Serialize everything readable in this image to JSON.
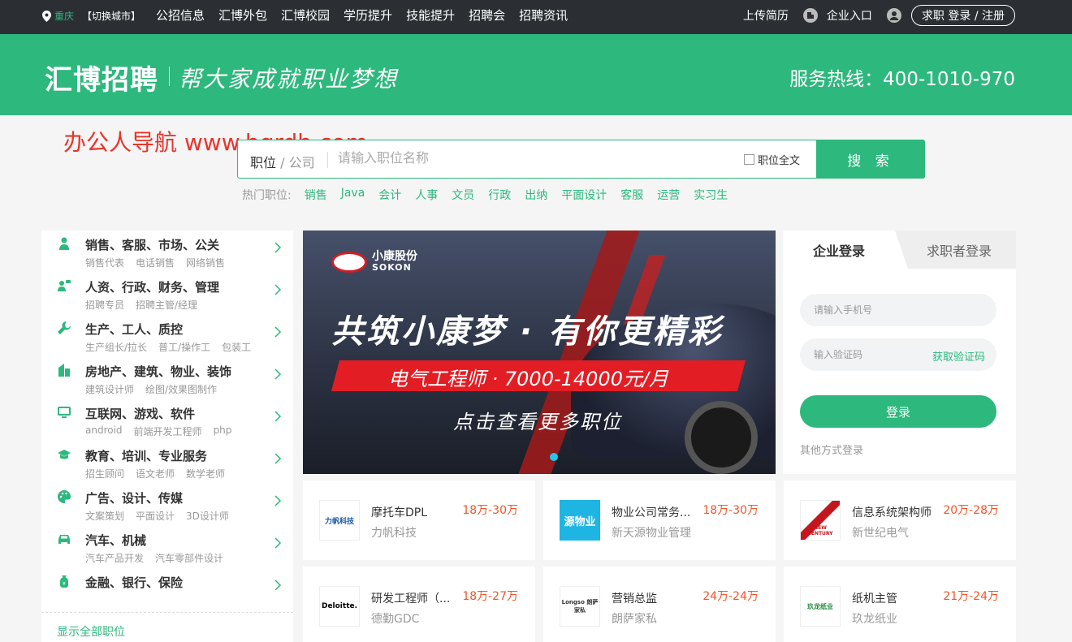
{
  "topbar": {
    "city": "重庆",
    "switch_city": "【切换城市】",
    "nav": [
      "公招信息",
      "汇博外包",
      "汇博校园",
      "学历提升",
      "技能提升",
      "招聘会",
      "招聘资讯"
    ],
    "upload_resume": "上传简历",
    "enterprise_entry": "企业入口",
    "jobseeker_login": "求职 登录 / 注册"
  },
  "header": {
    "logo": "汇博招聘",
    "slogan": "帮大家成就职业梦想",
    "hotline": "服务热线：400-1010-970"
  },
  "watermark": "办公人导航 www.bgrdh.com",
  "search": {
    "type_main": "职位",
    "type_sub": " / 公司",
    "placeholder": "请输入职位名称",
    "fulltext_label": "职位全文",
    "button": "搜 索"
  },
  "hot": {
    "label": "热门职位:",
    "keywords": [
      "销售",
      "Java",
      "会计",
      "人事",
      "文员",
      "行政",
      "出纳",
      "平面设计",
      "客服",
      "运营",
      "实习生"
    ]
  },
  "categories": [
    {
      "title": "销售、客服、市场、公关",
      "subs": [
        "销售代表",
        "电话销售",
        "网络销售"
      ],
      "icon": "person-icon"
    },
    {
      "title": "人资、行政、财务、管理",
      "subs": [
        "招聘专员",
        "招聘主管/经理"
      ],
      "icon": "team-icon"
    },
    {
      "title": "生产、工人、质控",
      "subs": [
        "生产组长/拉长",
        "普工/操作工",
        "包装工"
      ],
      "icon": "wrench-icon"
    },
    {
      "title": "房地产、建筑、物业、装饰",
      "subs": [
        "建筑设计师",
        "绘图/效果图制作"
      ],
      "icon": "building-icon"
    },
    {
      "title": "互联网、游戏、软件",
      "subs": [
        "android",
        "前端开发工程师",
        "php"
      ],
      "icon": "monitor-icon"
    },
    {
      "title": "教育、培训、专业服务",
      "subs": [
        "招生顾问",
        "语文老师",
        "数学老师"
      ],
      "icon": "graduation-cap-icon"
    },
    {
      "title": "广告、设计、传媒",
      "subs": [
        "文案策划",
        "平面设计",
        "3D设计师"
      ],
      "icon": "palette-icon"
    },
    {
      "title": "汽车、机械",
      "subs": [
        "汽车产品开发",
        "汽车零部件设计"
      ],
      "icon": "car-icon"
    },
    {
      "title": "金融、银行、保险",
      "subs": [],
      "icon": "money-bag-icon"
    }
  ],
  "show_all": "显示全部职位",
  "banner": {
    "brand_cn": "小康股份",
    "brand_en": "SOKON",
    "headline": "共筑小康梦 · 有你更精彩",
    "position": "电气工程师 · 7000-14000元/月",
    "cta": "点击查看更多职位"
  },
  "login": {
    "tab_company": "企业登录",
    "tab_seeker": "求职者登录",
    "phone_placeholder": "请输入手机号",
    "code_placeholder": "输入验证码",
    "get_code": "获取验证码",
    "submit": "登录",
    "other": "其他方式登录"
  },
  "jobs": [
    {
      "title": "摩托车DPL",
      "company": "力帆科技",
      "salary": "18万-30万",
      "logo_text": "力帆科技"
    },
    {
      "title": "物业公司常务...",
      "company": "新天源物业管理",
      "salary": "18万-30万",
      "logo_text": "源物业"
    },
    {
      "title": "信息系统架构师",
      "company": "新世纪电气",
      "salary": "20万-28万",
      "logo_text": "NEW CENTURY"
    },
    {
      "title": "研发工程师（...",
      "company": "德勤GDC",
      "salary": "18万-27万",
      "logo_text": "Deloitte."
    },
    {
      "title": "营销总监",
      "company": "朗萨家私",
      "salary": "24万-24万",
      "logo_text": "Longso 朗萨家私"
    },
    {
      "title": "纸机主管",
      "company": "玖龙纸业",
      "salary": "21万-24万",
      "logo_text": "玖龙纸业"
    }
  ],
  "colors": {
    "brand_green": "#2db87d",
    "topbar": "#2b2f33",
    "salary": "#f0552a"
  }
}
